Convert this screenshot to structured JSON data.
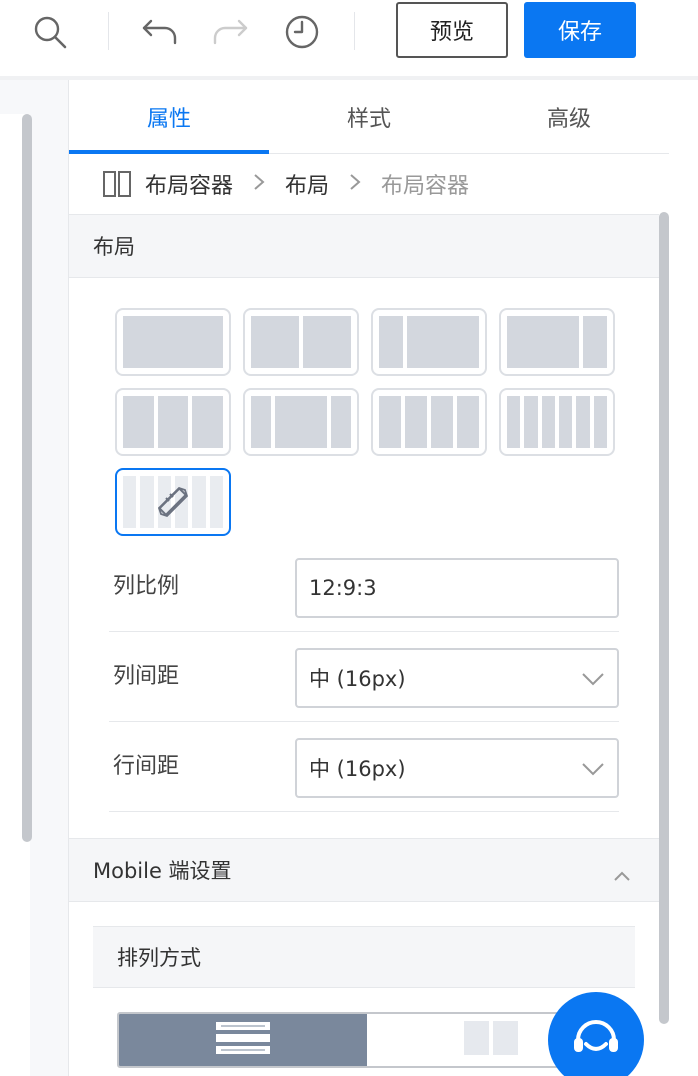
{
  "toolbar": {
    "preview_label": "预览",
    "save_label": "保存"
  },
  "tabs": [
    {
      "label": "属性"
    },
    {
      "label": "样式"
    },
    {
      "label": "高级"
    }
  ],
  "breadcrumb": [
    "布局容器",
    "布局",
    "布局容器"
  ],
  "layout_section": {
    "title": "布局"
  },
  "fields": {
    "column_ratio": {
      "label": "列比例",
      "value": "12:9:3"
    },
    "column_gap": {
      "label": "列间距",
      "value": "中 (16px)"
    },
    "row_gap": {
      "label": "行间距",
      "value": "中 (16px)"
    }
  },
  "mobile_section": {
    "title": "Mobile 端设置",
    "arrangement": {
      "title": "排列方式"
    }
  },
  "colors": {
    "primary": "#0a77f2",
    "segment_active": "#7a889c"
  }
}
